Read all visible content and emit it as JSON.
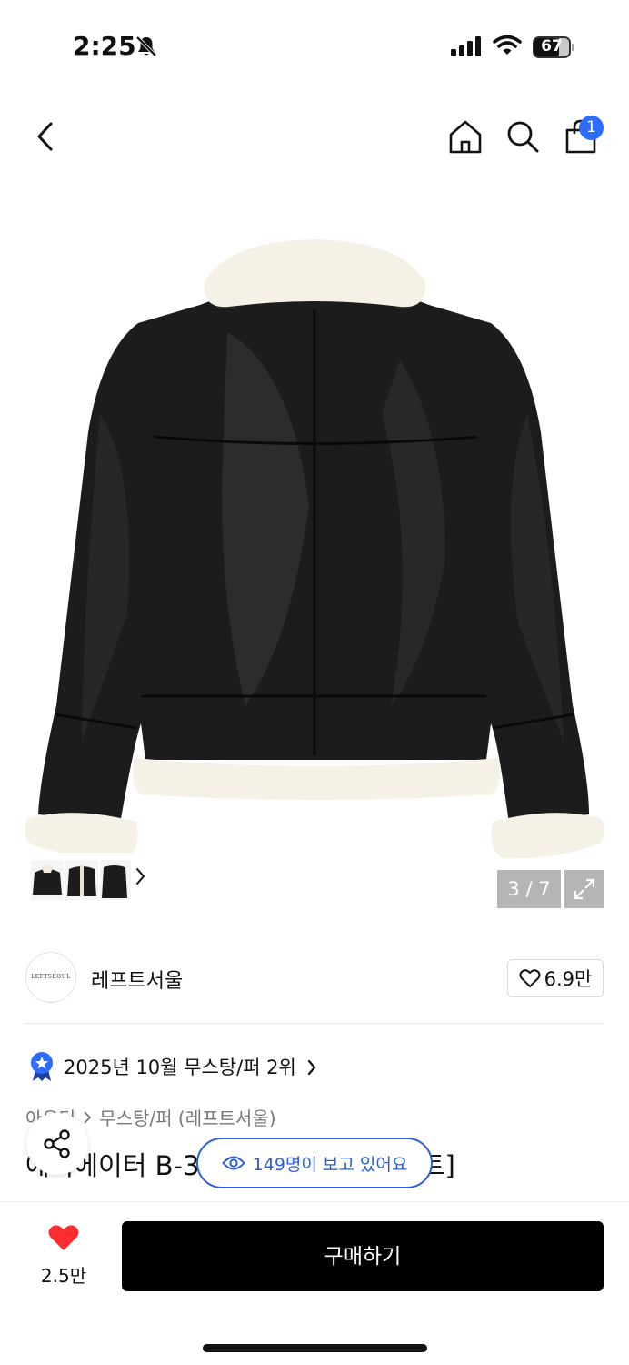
{
  "status_bar": {
    "time": "2:25",
    "battery": "67"
  },
  "nav": {
    "cart_count": "1"
  },
  "gallery": {
    "counter": "3 / 7"
  },
  "brand": {
    "logo_text": "LEFTSEOUL",
    "name": "레프트서울",
    "likes": "6.9만"
  },
  "ranking": {
    "text": "2025년 10월 무스탕/퍼 2위"
  },
  "breadcrumb": {
    "category": "아우터",
    "subcategory": "무스탕/퍼 (레프트서울)"
  },
  "product": {
    "title_start": "에비에이터 B-3",
    "title_end": "화이트]"
  },
  "viewers": {
    "text": "149명이 보고 있어요"
  },
  "bottom": {
    "wish_count": "2.5만",
    "buy_label": "구매하기"
  },
  "colors": {
    "accent": "#2c6cff",
    "viewer_blue": "#2c5fd6",
    "heart": "#ff2d2d"
  }
}
